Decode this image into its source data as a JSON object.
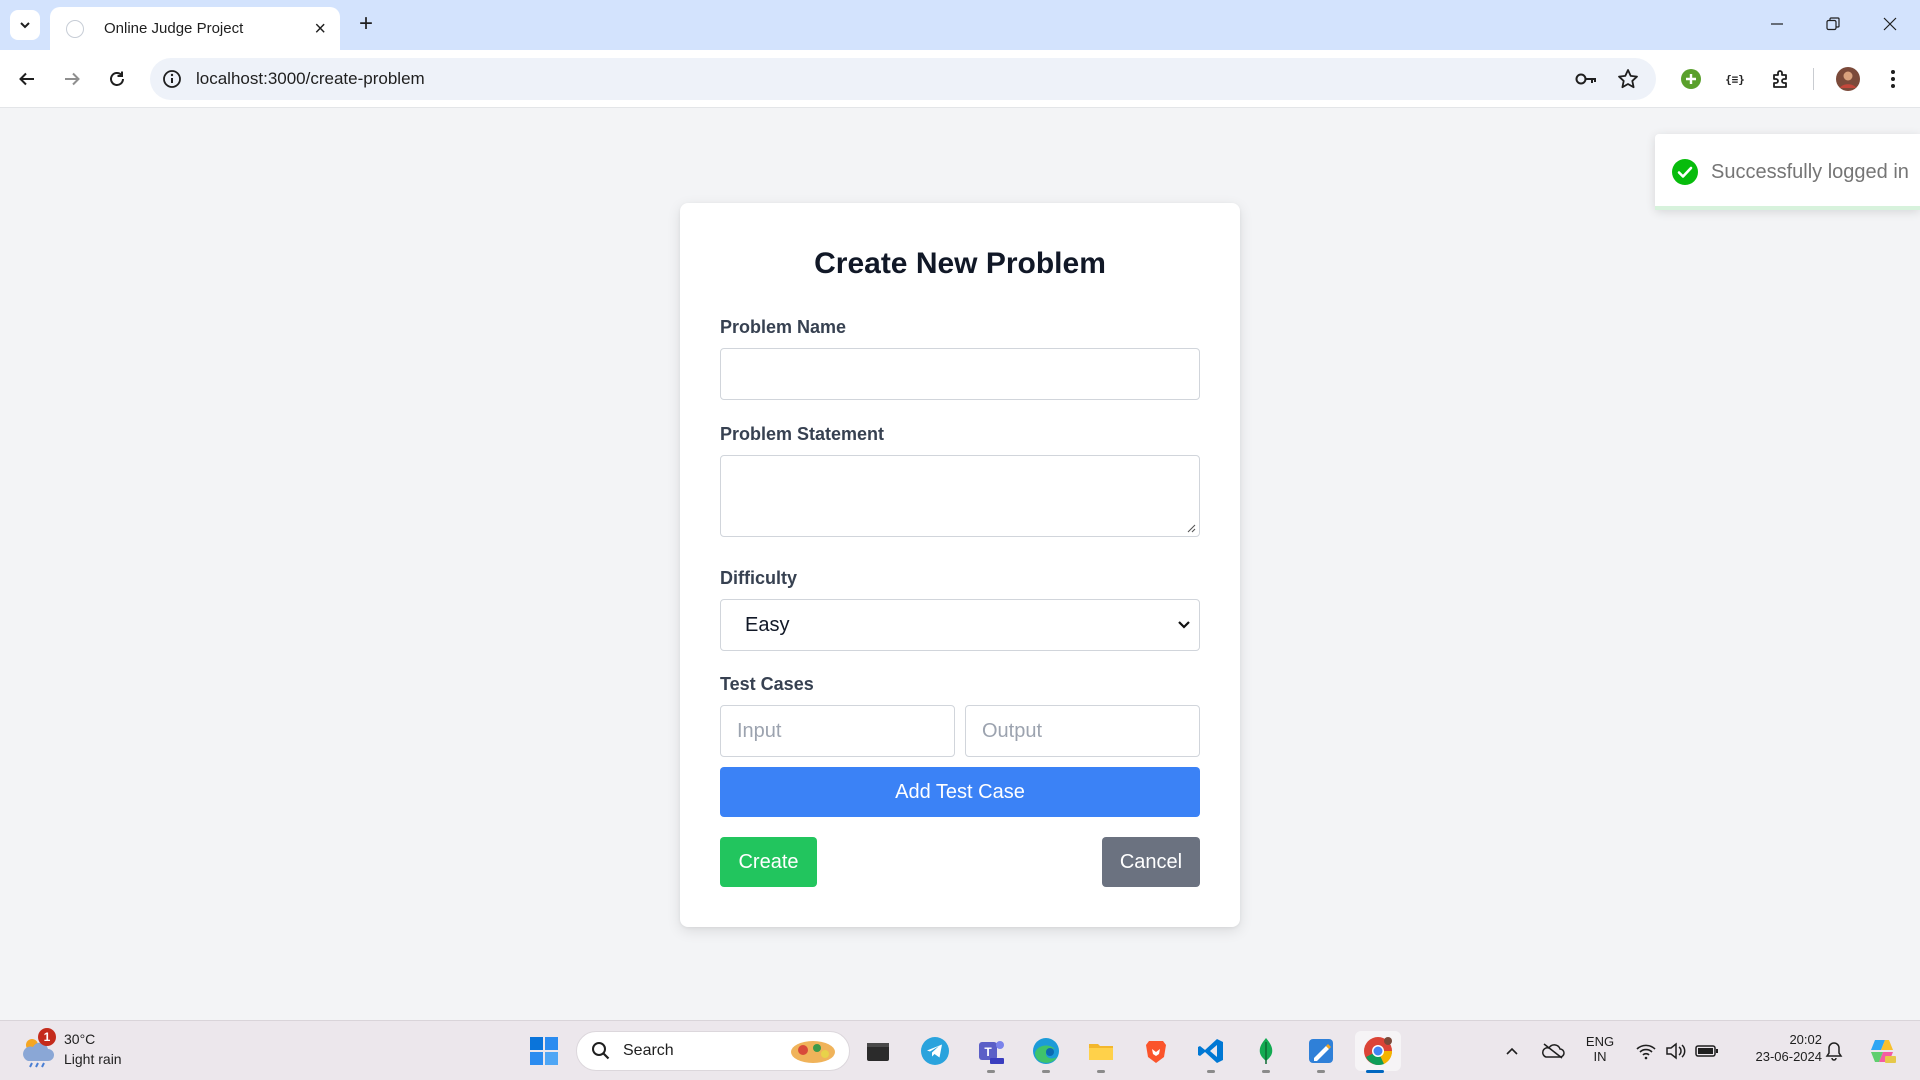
{
  "browser": {
    "tab_title": "Online Judge Project",
    "url": "localhost:3000/create-problem"
  },
  "form": {
    "title": "Create New Problem",
    "problem_name_label": "Problem Name",
    "problem_name_value": "",
    "problem_statement_label": "Problem Statement",
    "problem_statement_value": "",
    "difficulty_label": "Difficulty",
    "difficulty_value": "Easy",
    "test_cases_label": "Test Cases",
    "input_placeholder": "Input",
    "output_placeholder": "Output",
    "add_test_case_label": "Add Test Case",
    "create_label": "Create",
    "cancel_label": "Cancel"
  },
  "toast": {
    "message": "Successfully logged in"
  },
  "colors": {
    "primary_blue": "#3b82f6",
    "create_green": "#22c55e",
    "cancel_gray": "#6b7280",
    "toast_success": "#07bc0c"
  },
  "taskbar": {
    "weather_temp": "30°C",
    "weather_desc": "Light rain",
    "weather_badge": "1",
    "search_label": "Search",
    "lang_primary": "ENG",
    "lang_secondary": "IN",
    "time": "20:02",
    "date": "23-06-2024",
    "pinned_apps": [
      "windows-start-icon",
      "file-explorer-dark-icon",
      "telegram-icon",
      "teams-icon",
      "edge-icon",
      "file-explorer-icon",
      "brave-icon",
      "vscode-icon",
      "mongodb-compass-icon",
      "paint-icon",
      "chrome-icon"
    ]
  }
}
